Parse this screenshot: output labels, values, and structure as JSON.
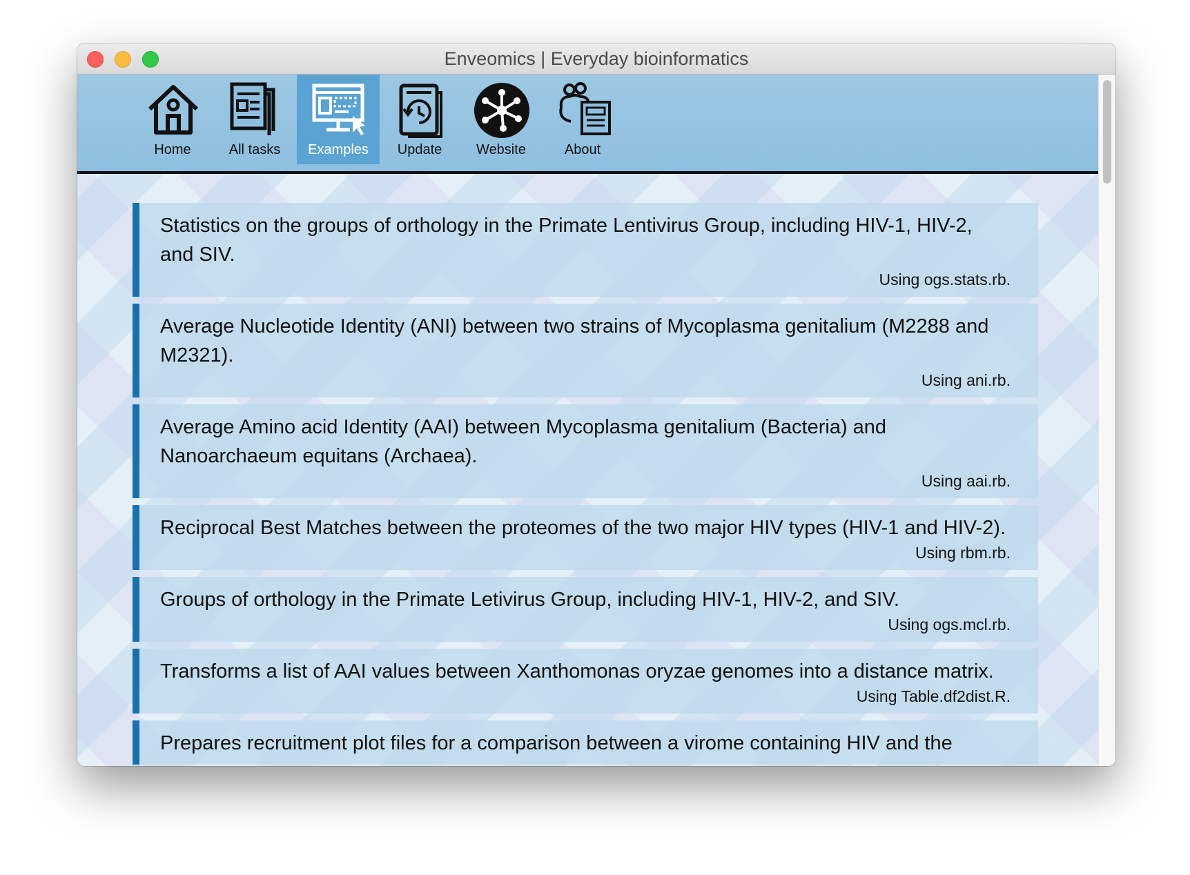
{
  "window": {
    "title": "Enveomics | Everyday bioinformatics"
  },
  "nav": {
    "items": [
      {
        "label": "Home",
        "icon": "home-icon"
      },
      {
        "label": "All tasks",
        "icon": "tasks-icon"
      },
      {
        "label": "Examples",
        "icon": "examples-icon",
        "active": true
      },
      {
        "label": "Update",
        "icon": "update-icon"
      },
      {
        "label": "Website",
        "icon": "website-icon"
      },
      {
        "label": "About",
        "icon": "about-icon"
      }
    ]
  },
  "examples": [
    {
      "description": "Statistics on the groups of orthology in the Primate Lentivirus Group, including HIV-1, HIV-2, and SIV.",
      "script": "Using ogs.stats.rb."
    },
    {
      "description": "Average Nucleotide Identity (ANI) between two strains of Mycoplasma genitalium (M2288 and M2321).",
      "script": "Using ani.rb."
    },
    {
      "description": "Average Amino acid Identity (AAI) between Mycoplasma genitalium (Bacteria) and Nanoarchaeum equitans (Archaea).",
      "script": "Using aai.rb."
    },
    {
      "description": "Reciprocal Best Matches between the proteomes of the two major HIV types (HIV-1 and HIV-2).",
      "script": "Using rbm.rb."
    },
    {
      "description": "Groups of orthology in the Primate Letivirus Group, including HIV-1, HIV-2, and SIV.",
      "script": "Using ogs.mcl.rb."
    },
    {
      "description": "Transforms a list of AAI values between Xanthomonas oryzae genomes into a distance matrix.",
      "script": "Using Table.df2dist.R."
    },
    {
      "description": "Prepares recruitment plot files for a comparison between a virome containing HIV and the",
      "script": ""
    }
  ],
  "colors": {
    "accent": "#1a6fae",
    "toolbar": "#93c2e1",
    "active_tab": "#5aa3d2"
  }
}
